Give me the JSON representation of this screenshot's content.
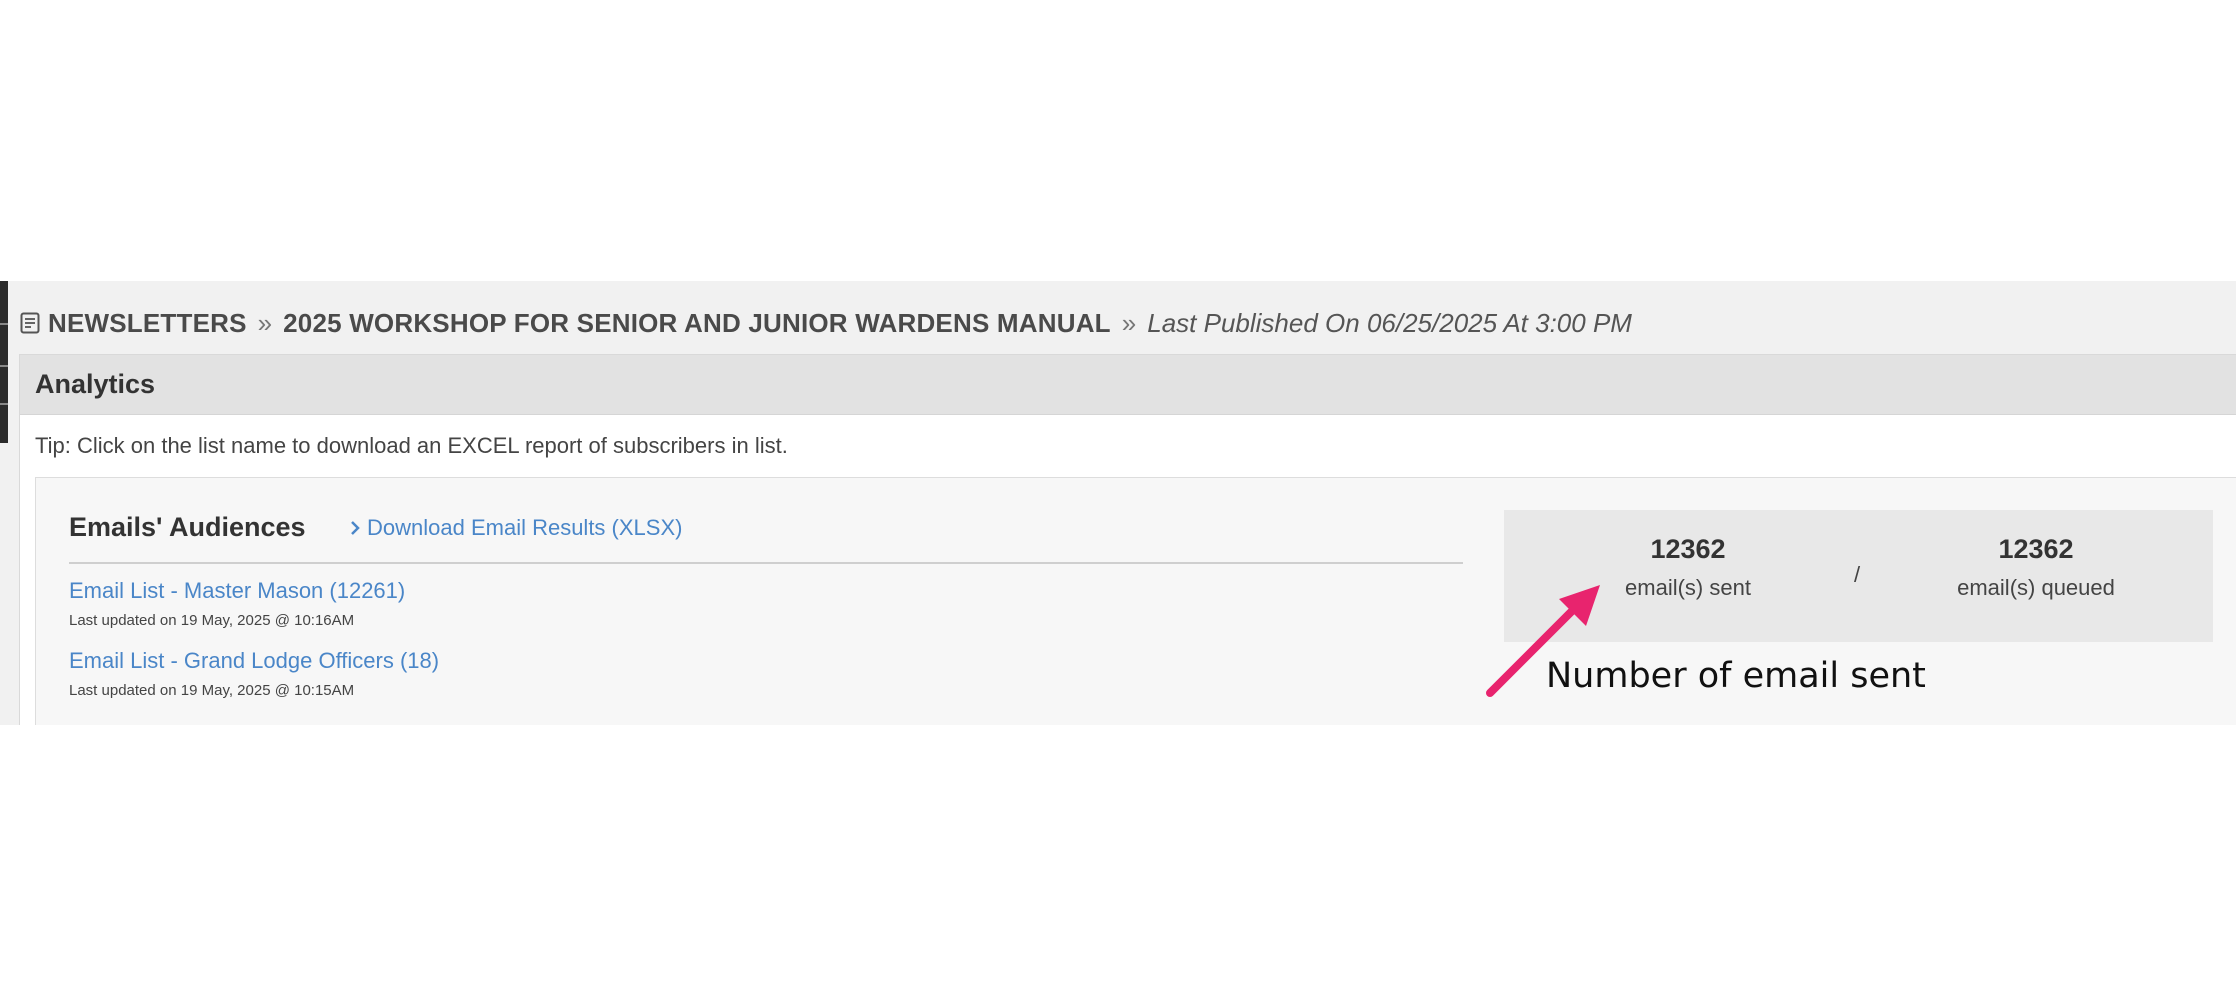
{
  "breadcrumb": {
    "section": "NEWSLETTERS",
    "separator": "»",
    "item": "2025 WORKSHOP FOR SENIOR AND JUNIOR WARDENS MANUAL",
    "published": "Last Published On 06/25/2025 At 3:00 PM"
  },
  "panel": {
    "title": "Analytics",
    "tip": "Tip: Click on the list name to download an EXCEL report of subscribers in list."
  },
  "audiences": {
    "title": "Emails' Audiences",
    "download_label": "Download Email Results (XLSX)",
    "lists": [
      {
        "name": "Email List - Master Mason (12261)",
        "updated": "Last updated on 19 May, 2025 @ 10:16AM"
      },
      {
        "name": "Email List - Grand Lodge Officers (18)",
        "updated": "Last updated on 19 May, 2025 @ 10:15AM"
      }
    ]
  },
  "stats": {
    "sent_count": "12362",
    "sent_label": "email(s) sent",
    "divider": "/",
    "queued_count": "12362",
    "queued_label": "email(s) queued"
  },
  "annotation": {
    "text": "Number of email sent",
    "color": "#e8246e"
  }
}
